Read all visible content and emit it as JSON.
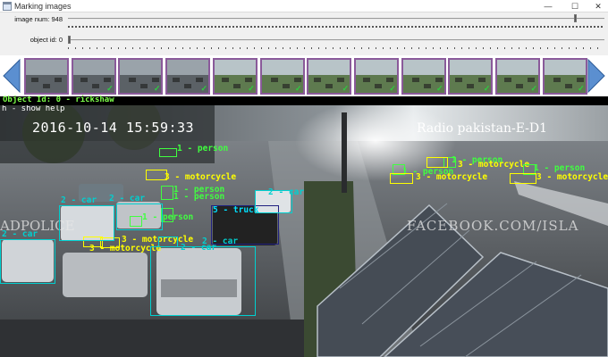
{
  "window": {
    "title": "Marking images",
    "controls": {
      "minimize": "—",
      "maximize": "☐",
      "close": "✕"
    }
  },
  "trackbars": {
    "image_num": {
      "label": "image num: 948",
      "fraction": 0.945
    },
    "object_id": {
      "label": "object id: 0",
      "fraction": 0.0
    }
  },
  "thumbnails": [
    {
      "checked": false,
      "tone": "dark"
    },
    {
      "checked": true,
      "tone": "dark"
    },
    {
      "checked": true,
      "tone": "dark"
    },
    {
      "checked": true,
      "tone": "dark"
    },
    {
      "checked": true,
      "tone": "green"
    },
    {
      "checked": true,
      "tone": "green"
    },
    {
      "checked": true,
      "tone": "green"
    },
    {
      "checked": true,
      "tone": "green"
    },
    {
      "checked": true,
      "tone": "green"
    },
    {
      "checked": true,
      "tone": "green"
    },
    {
      "checked": true,
      "tone": "green"
    },
    {
      "checked": true,
      "tone": "green"
    }
  ],
  "status_line": "Object Id: 0   - rickshaw",
  "help_text": "h - show help",
  "image": {
    "timestamp": "2016-10-14 15:59:33",
    "watermark_right": "Radio pakistan-E-D1",
    "watermark_left": "ADPOLICE",
    "watermark_fb": "FACEBOOK.COM/ISLA"
  },
  "annotations": [
    {
      "text": "1 - person",
      "color": "#40ff40"
    },
    {
      "text": "3 - motorcycle",
      "color": "#ffff00"
    },
    {
      "text": "1 - person",
      "color": "#40ff40"
    },
    {
      "text": "1 - person",
      "color": "#40ff40"
    },
    {
      "text": "1 - person",
      "color": "#40ff40"
    },
    {
      "text": "3 - motorcycle",
      "color": "#ffff00"
    },
    {
      "text": "3 - motorcycle",
      "color": "#ffff00"
    },
    {
      "text": "2 - car",
      "color": "#00d0d0"
    },
    {
      "text": "5 - truck",
      "color": "#00d0d0"
    },
    {
      "text": "2 - car",
      "color": "#00d0d0"
    },
    {
      "text": "1 - person",
      "color": "#40ff40"
    },
    {
      "text": "3 - motorcycle",
      "color": "#ffff00"
    },
    {
      "text": "1 - person",
      "color": "#40ff40"
    },
    {
      "text": "3 - motorcycle",
      "color": "#ffff00"
    },
    {
      "text": "1 - person",
      "color": "#40ff40"
    },
    {
      "text": "3 - motorcycle",
      "color": "#ffff00"
    },
    {
      "text": "2 - car",
      "color": "#00d0d0"
    },
    {
      "text": "2 - car",
      "color": "#00d0d0"
    },
    {
      "text": "2 - car",
      "color": "#00d0d0"
    },
    {
      "text": "2 - car",
      "color": "#00d0d0"
    }
  ],
  "colors": {
    "person": "#40ff40",
    "motorcycle": "#ffff00",
    "car": "#00d0d0",
    "truck": "#202080",
    "nav_arrow": "#5b8fd0",
    "status_text": "#7dff4a"
  },
  "icons": {
    "app": "app-window-icon",
    "prev": "arrow-left-icon",
    "next": "arrow-right-icon",
    "check": "checkmark-icon"
  }
}
